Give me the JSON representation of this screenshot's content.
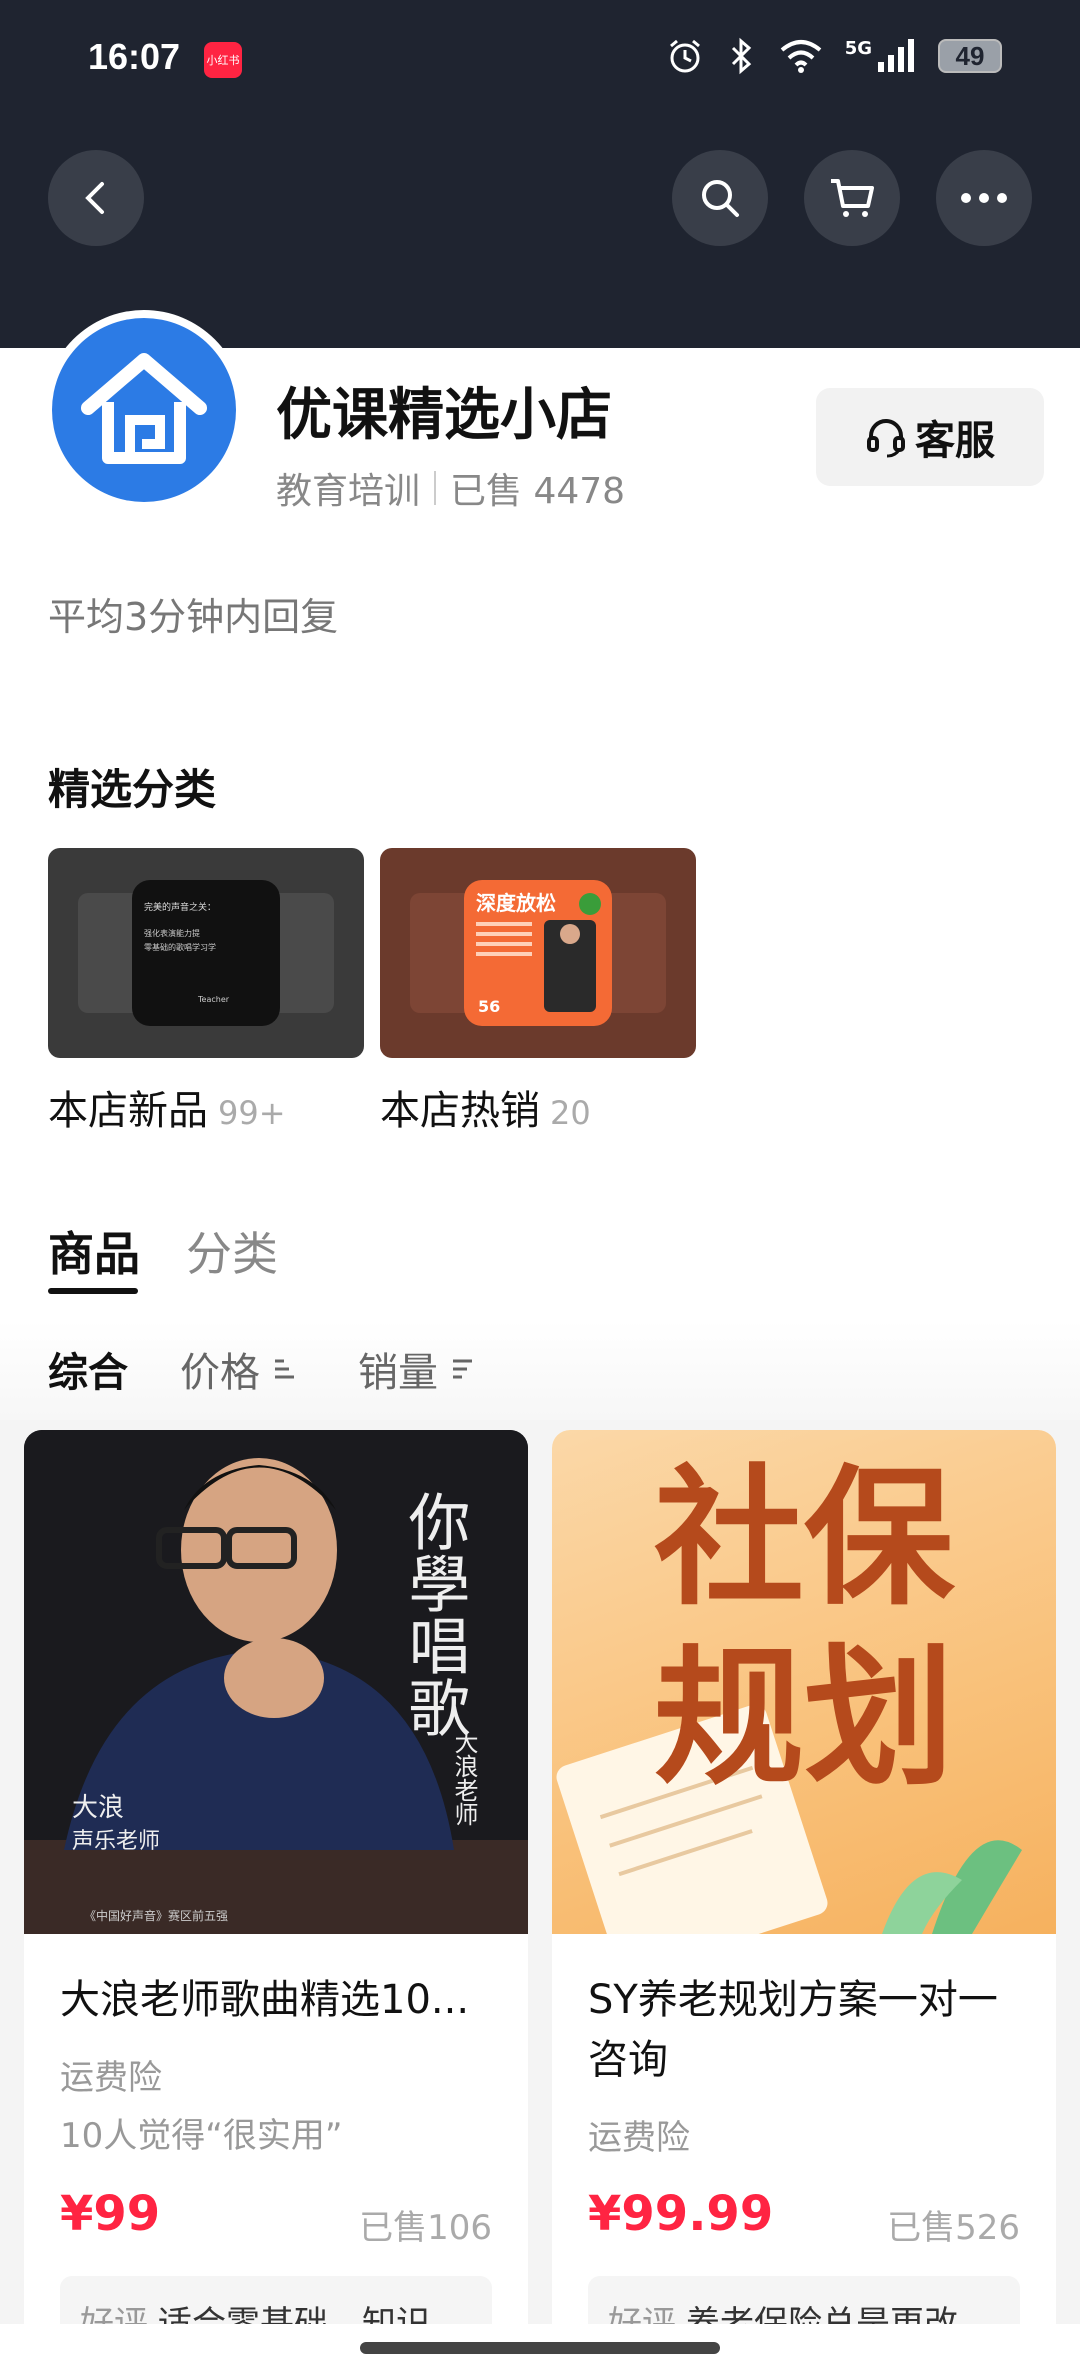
{
  "status_bar": {
    "time": "16:07",
    "app_badge": "小红书",
    "network": "5G",
    "battery": "49"
  },
  "header": {
    "icons": [
      "back-icon",
      "search-icon",
      "cart-icon",
      "more-icon"
    ],
    "background": "#1f2430"
  },
  "shop": {
    "name": "优课精选小店",
    "category": "教育培训",
    "sold": "已售 4478",
    "service_label": "客服",
    "reply_note": "平均3分钟内回复",
    "avatar_color": "#2c7be5"
  },
  "featured": {
    "title": "精选分类",
    "items": [
      {
        "label": "本店新品",
        "count": "99+",
        "thumb_lines": [
          "完美的声音之关：",
          "强化表演能力提",
          "零基础的歌唱学习学",
          "Teacher"
        ]
      },
      {
        "label": "本店热销",
        "count": "20",
        "thumb_title": "深度放松",
        "thumb_number": "56"
      }
    ]
  },
  "tabs": [
    {
      "label": "商品",
      "active": true
    },
    {
      "label": "分类",
      "active": false
    }
  ],
  "sort": {
    "all": "综合",
    "price": "价格",
    "sales": "销量"
  },
  "products": [
    {
      "title": "大浪老师歌曲精选10...",
      "tag": "运费险",
      "note": "10人觉得“很实用”",
      "price": "¥99",
      "sold": "已售106",
      "review_label": "好评",
      "review_text": "适合零基础，知识",
      "image_text": {
        "headline": "你學唱歌",
        "teacher": "大浪老师",
        "subtitle_left": "大浪",
        "subtitle_role": "声乐老师",
        "footer": "《中国好声音》赛区前五强"
      }
    },
    {
      "title": "SY养老规划方案一对一咨询",
      "tag": "运费险",
      "price": "¥99.99",
      "sold": "已售526",
      "review_label": "好评",
      "review_text": "养老保险总是更改",
      "image_text": {
        "line1": "社保",
        "line2": "规划"
      }
    }
  ],
  "colors": {
    "price": "#ff2442",
    "accent_blue": "#2c7be5"
  }
}
